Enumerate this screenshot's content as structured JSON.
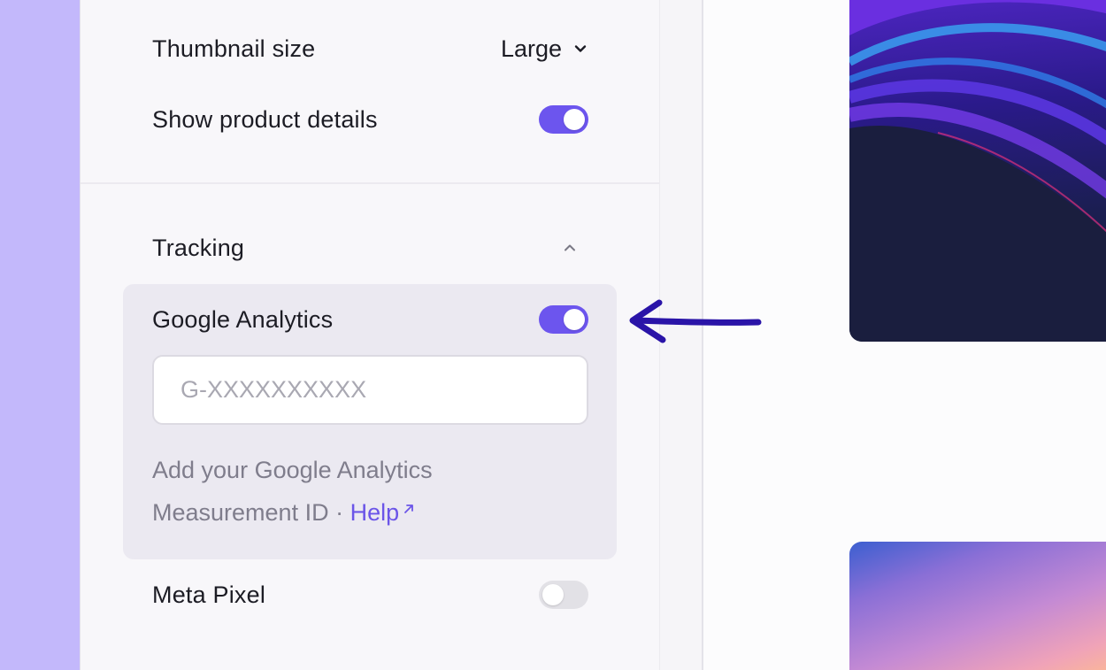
{
  "display": {
    "thumbnail_size_label": "Thumbnail size",
    "thumbnail_size_value": "Large",
    "show_product_details_label": "Show product details",
    "show_product_details_on": true
  },
  "tracking": {
    "section_title": "Tracking",
    "google_analytics": {
      "label": "Google Analytics",
      "enabled": true,
      "input_value": "",
      "input_placeholder": "G-XXXXXXXXXX",
      "helper_text": "Add your Google Analytics Measurement ID · ",
      "help_link": "Help"
    },
    "meta_pixel": {
      "label": "Meta Pixel",
      "enabled": false
    }
  },
  "icons": {
    "dropdown": "chevron-down-icon",
    "collapse": "chevron-up-icon",
    "external": "external-link-icon",
    "annotation": "arrow-left-icon"
  },
  "colors": {
    "accent": "#6c55ee",
    "toggle_off": "#e2e1e6",
    "left_strip": "#c3b8fb",
    "annotation_arrow": "#2a14a8"
  }
}
